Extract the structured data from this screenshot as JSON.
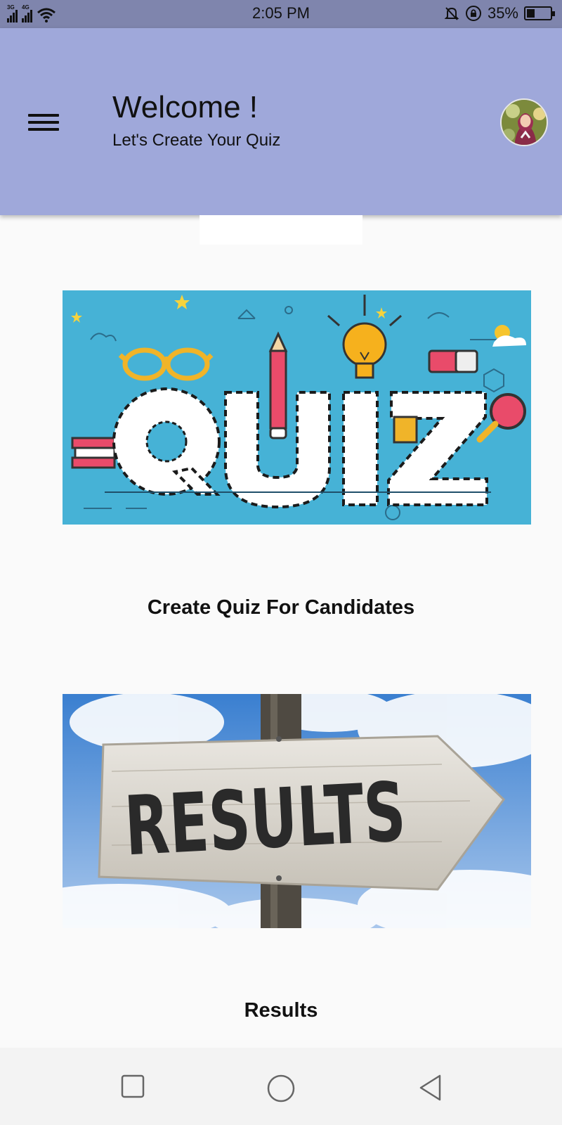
{
  "status_bar": {
    "network_1": "3G",
    "network_2": "4G",
    "time": "2:05 PM",
    "battery_percent": "35%",
    "battery_level": 0.35,
    "icons": [
      "signal-icon",
      "wifi-icon",
      "mute-icon",
      "rotation-lock-icon",
      "battery-icon"
    ]
  },
  "header": {
    "menu_icon": "hamburger-menu-icon",
    "title": "Welcome !",
    "subtitle": "Let's Create Your Quiz",
    "avatar": "profile-avatar"
  },
  "cards": [
    {
      "label": "Create Quiz For Candidates",
      "image_text": "QUIZ"
    },
    {
      "label": "Results",
      "image_text": "RESULTS"
    }
  ],
  "nav_bar": {
    "buttons": [
      "recent-apps-icon",
      "home-icon",
      "back-icon"
    ]
  },
  "colors": {
    "status_bar": "#7f85ad",
    "app_bar": "#9fa8da",
    "background": "#fafafa",
    "quiz_bg": "#46b2d6",
    "sky": "#3a7fd0"
  }
}
